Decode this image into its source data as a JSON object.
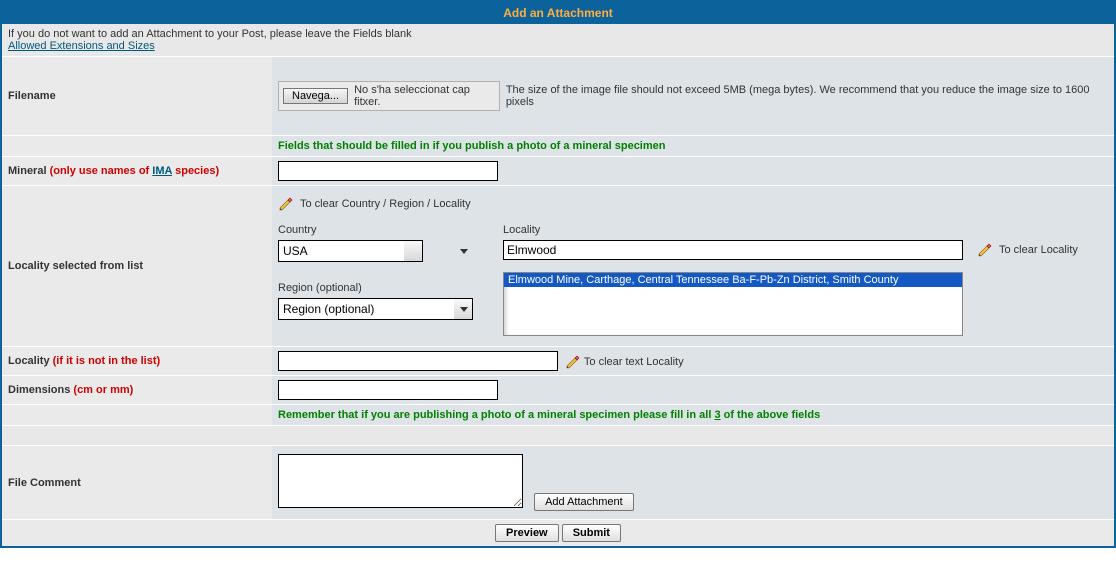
{
  "title": "Add an Attachment",
  "intro": {
    "line1": "If you do not want to add an Attachment to your Post, please leave the Fields blank",
    "link": "Allowed Extensions and Sizes"
  },
  "labels": {
    "filename": "Filename",
    "mineral_pre": "Mineral ",
    "mineral_red1": "(only use names of ",
    "mineral_link": "IMA",
    "mineral_red2": " species)",
    "locality_list": "Locality selected from list",
    "locality_free_pre": "Locality ",
    "locality_free_red": "(if it is not in the list)",
    "dimensions_pre": "Dimensions ",
    "dimensions_red": "(cm or mm)",
    "file_comment": "File Comment"
  },
  "file": {
    "button": "Navega...",
    "status": "No s'ha seleccionat cap fitxer.",
    "hint": "The size of the image file should not exceed 5MB (mega bytes). We recommend that you reduce the image size to 1600 pixels"
  },
  "notes": {
    "green1": "Fields that should be filled in if you publish a photo of a mineral specimen",
    "green2_pre": "Remember that if you are publishing a photo of a mineral specimen please fill in all ",
    "green2_num": "3",
    "green2_post": " of the above fields"
  },
  "locality": {
    "clear_all": "To clear Country / Region / Locality",
    "country_label": "Country",
    "country_value": "USA",
    "region_label": "Region (optional)",
    "region_value": "Region (optional)",
    "locality_label": "Locality",
    "locality_value": "Elmwood",
    "dropdown_item": "Elmwood Mine, Carthage, Central Tennessee Ba-F-Pb-Zn District, Smith County",
    "clear_locality": "To clear Locality",
    "clear_text_locality": "To clear text Locality"
  },
  "buttons": {
    "add_attach": "Add Attachment",
    "preview": "Preview",
    "submit": "Submit"
  },
  "values": {
    "mineral": "",
    "locality_free": "",
    "dimensions": "",
    "comment": ""
  }
}
